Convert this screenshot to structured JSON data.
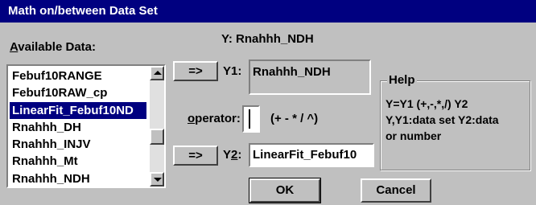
{
  "window": {
    "title": "Math on/between Data Set"
  },
  "available": {
    "label_underlined": "A",
    "label_rest": "vailable Data:",
    "items": [
      "Febuf10RANGE",
      "Febuf10RAW_cp",
      "LinearFit_Febuf10ND",
      "Rnahhh_DH",
      "Rnahhh_INJV",
      "Rnahhh_Mt",
      "Rnahhh_NDH"
    ],
    "selected_index": 2
  },
  "result": {
    "label": "Y: Rnahhh_NDH"
  },
  "y1": {
    "arrow_button": "=>",
    "label": "Y1:",
    "value": "Rnahhh_NDH"
  },
  "operator": {
    "label_underlined": "o",
    "label_rest": "perator:",
    "value": "",
    "hint": "(+ - * / ^)"
  },
  "y2": {
    "arrow_button": "=>",
    "label_prefix": "Y",
    "label_underlined": "2",
    "label_suffix": ":",
    "value": "LinearFit_Febuf10"
  },
  "help": {
    "title": "Help",
    "lines": [
      "Y=Y1 (+,-,*,/) Y2",
      "Y,Y1:data set  Y2:data",
      "or number"
    ]
  },
  "buttons": {
    "ok": "OK",
    "cancel": "Cancel"
  }
}
